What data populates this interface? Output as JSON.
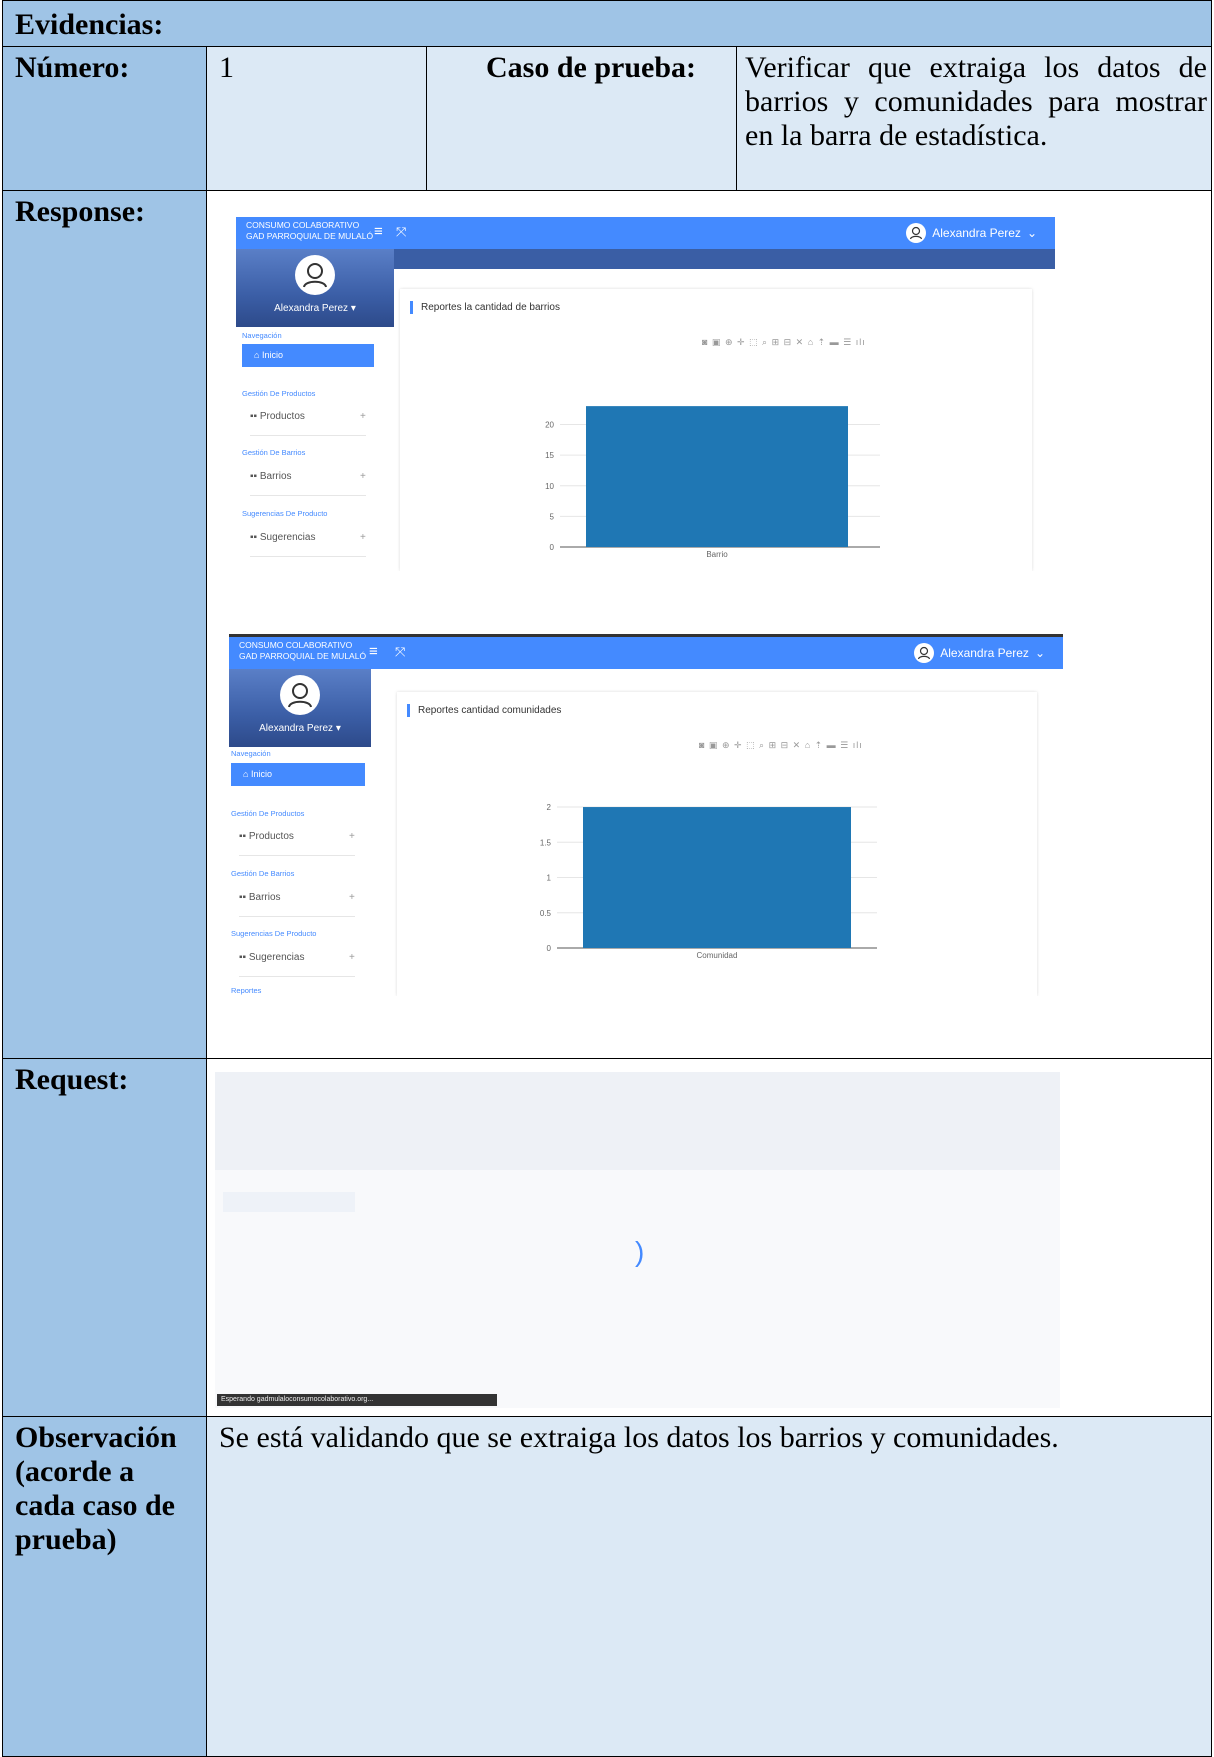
{
  "table": {
    "header": "Evidencias:",
    "numero_label": "Número:",
    "numero_value": "1",
    "caso_label": "Caso de prueba:",
    "caso_value": "Verificar que extraiga los datos de barrios y comunidades para mostrar en la barra de estadística.",
    "response_label": "Response:",
    "request_label": "Request:",
    "observacion_label": "Observación (acorde a cada caso de prueba)",
    "observacion_value": "Se está validando que se extraiga los datos los barrios y comunidades."
  },
  "app": {
    "brand_line1": "CONSUMO COLABORATIVO",
    "brand_line2": "GAD PARROQUIAL DE MULALÓ",
    "user_name": "Alexandra Perez",
    "user_name_profile": "Alexandra Perez ▾",
    "nav_heading": "Navegación",
    "inicio": "Inicio",
    "grp_productos": "Gestión De Productos",
    "item_productos": "Productos",
    "grp_barrios": "Gestión De Barrios",
    "item_barrios": "Barrios",
    "grp_sugerencias": "Sugerencias De Producto",
    "item_sugerencias": "Sugerencias",
    "grp_reportes": "Reportes",
    "plus": "+",
    "toolbar": "◙ ▣ ⊕ ✛ ⬚ ⌕ ⊞ ⊟ ✕ ⌂ ⇡ ▬ ☰ ılı",
    "status_text": "Esperando gadmulaloconsumocolaborativo.org..."
  },
  "screens": [
    {
      "card_title": "Reportes la cantidad de barrios"
    },
    {
      "card_title": "Reportes cantidad comunidades"
    }
  ],
  "colors": {
    "header_bg": "#9fc4e6",
    "row_bg": "#dce9f5",
    "topbar": "#448aff",
    "bar": "#1f77b4"
  },
  "chart_data": [
    {
      "type": "bar",
      "categories": [
        "Barrio"
      ],
      "values": [
        23
      ],
      "ylim": [
        0,
        24
      ],
      "yticks": [
        0,
        5,
        10,
        15,
        20
      ]
    },
    {
      "type": "bar",
      "categories": [
        "Comunidad"
      ],
      "values": [
        2
      ],
      "ylim": [
        0,
        2.1
      ],
      "yticks": [
        0,
        0.5,
        1,
        1.5,
        2
      ]
    }
  ]
}
